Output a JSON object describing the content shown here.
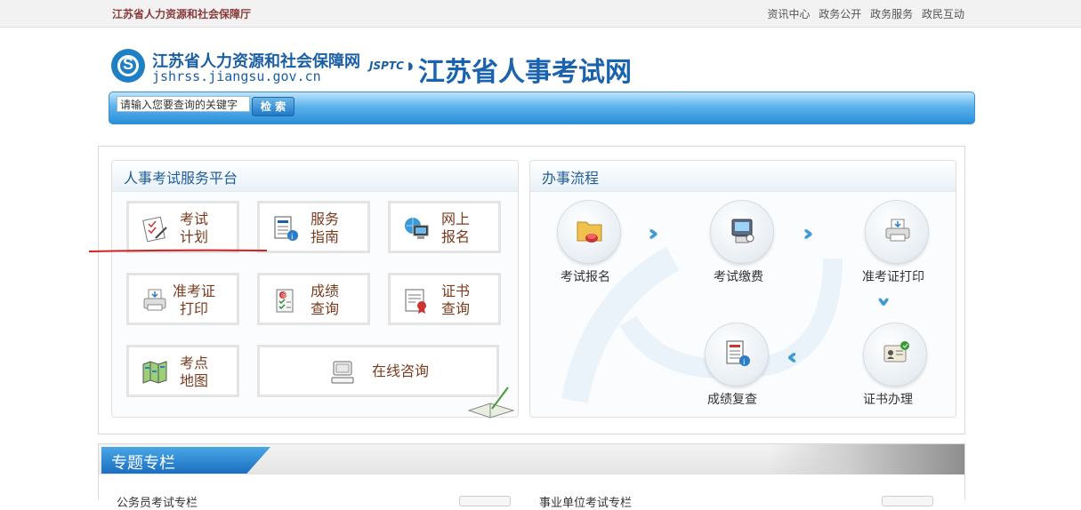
{
  "topbar": {
    "org_name": "江苏省人力资源和社会保障厅",
    "nav": [
      "资讯中心",
      "政务公开",
      "政务服务",
      "政民互动"
    ]
  },
  "header": {
    "site_name": "江苏省人力资源和社会保障网",
    "site_url": "jshrss.jiangsu.gov.cn",
    "exam_logo_text": "JSPTC",
    "exam_site_title": "江苏省人事考试网"
  },
  "search": {
    "placeholder": "请输入您要查询的关键字",
    "button_label": "检 索"
  },
  "service_platform": {
    "title": "人事考试服务平台",
    "tiles": [
      {
        "label_line1": "考试",
        "label_line2": "计划"
      },
      {
        "label_line1": "服务",
        "label_line2": "指南"
      },
      {
        "label_line1": "网上",
        "label_line2": "报名"
      },
      {
        "label_line1": "准考证",
        "label_line2": "打印"
      },
      {
        "label_line1": "成绩",
        "label_line2": "查询"
      },
      {
        "label_line1": "证书",
        "label_line2": "查询"
      },
      {
        "label_line1": "考点",
        "label_line2": "地图"
      }
    ],
    "online_consult": "在线咨询"
  },
  "process": {
    "title": "办事流程",
    "steps": [
      "考试报名",
      "考试缴费",
      "准考证打印",
      "证书办理",
      "成绩复查"
    ]
  },
  "special": {
    "title": "专题专栏",
    "sub_left": "公务员考试专栏",
    "sub_right": "事业单位考试专栏"
  }
}
